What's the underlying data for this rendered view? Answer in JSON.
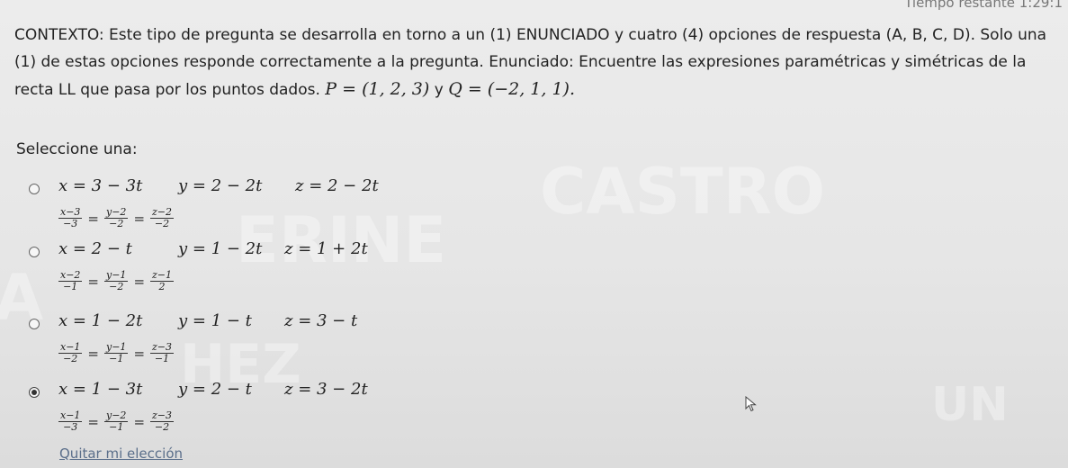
{
  "timer": "Tiempo restante 1:29:1",
  "context_text": "CONTEXTO: Este tipo de pregunta se desarrolla en torno a un (1) ENUNCIADO y cuatro (4) opciones de respuesta (A, B, C, D). Solo una (1) de estas opciones responde correctamente a la pregunta. Enunciado: Encuentre las expresiones paramétricas y simétricas de la recta LL que pasa por los puntos dados.",
  "point_p": "P = (1, 2, 3)",
  "and_word": "y",
  "point_q": "Q = (−2, 1, 1).",
  "prompt": "Seleccione una:",
  "options": [
    {
      "checked": false,
      "x_eq": "x = 3 − 3t",
      "y_eq": "y = 2 − 2t",
      "z_eq": "z = 2 − 2t",
      "sym": [
        {
          "num": "x−3",
          "den": "−3"
        },
        {
          "num": "y−2",
          "den": "−2"
        },
        {
          "num": "z−2",
          "den": "−2"
        }
      ]
    },
    {
      "checked": false,
      "x_eq": "x = 2 − t",
      "y_eq": "y = 1 − 2t",
      "z_eq": "z = 1 + 2t",
      "sym": [
        {
          "num": "x−2",
          "den": "−1"
        },
        {
          "num": "y−1",
          "den": "−2"
        },
        {
          "num": "z−1",
          "den": "2"
        }
      ]
    },
    {
      "checked": false,
      "x_eq": "x = 1 − 2t",
      "y_eq": "y = 1 − t",
      "z_eq": "z = 3 − t",
      "sym": [
        {
          "num": "x−1",
          "den": "−2"
        },
        {
          "num": "y−1",
          "den": "−1"
        },
        {
          "num": "z−3",
          "den": "−1"
        }
      ]
    },
    {
      "checked": true,
      "x_eq": "x = 1 − 3t",
      "y_eq": "y = 2 − t",
      "z_eq": "z = 3 − 2t",
      "sym": [
        {
          "num": "x−1",
          "den": "−3"
        },
        {
          "num": "y−2",
          "den": "−1"
        },
        {
          "num": "z−3",
          "den": "−2"
        }
      ]
    }
  ],
  "clear_choice": "Quitar mi elección",
  "watermarks": [
    "CASTRO",
    "ERINE",
    "A",
    "HEZ",
    "UN"
  ],
  "colors": {
    "link": "#5a6e8a",
    "text": "#222222"
  }
}
